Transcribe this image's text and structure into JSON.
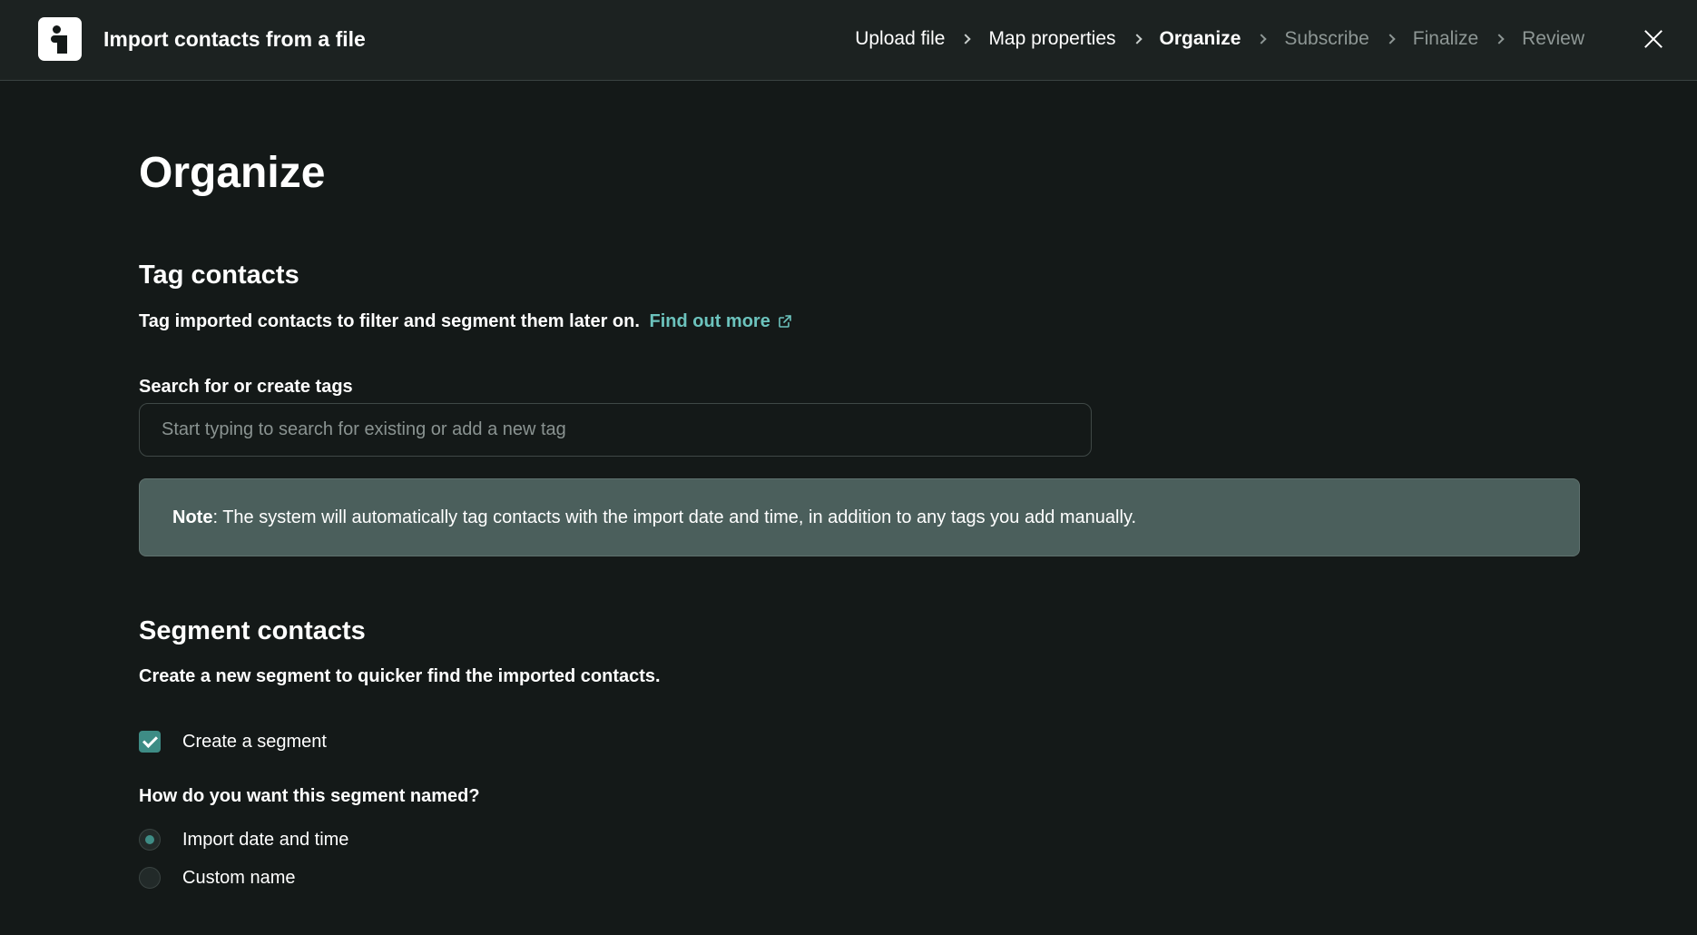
{
  "header": {
    "app_title": "Import contacts from a file",
    "steps": [
      {
        "label": "Upload file",
        "state": "done"
      },
      {
        "label": "Map properties",
        "state": "done"
      },
      {
        "label": "Organize",
        "state": "current"
      },
      {
        "label": "Subscribe",
        "state": "future"
      },
      {
        "label": "Finalize",
        "state": "future"
      },
      {
        "label": "Review",
        "state": "future"
      }
    ],
    "close_icon": "close-icon"
  },
  "main": {
    "page_title": "Organize",
    "tag_section": {
      "title": "Tag contacts",
      "description": "Tag imported contacts to filter and segment them later on.",
      "link_text": "Find out more",
      "link_icon": "external-link-icon",
      "search_label": "Search for or create tags",
      "search_value": "",
      "search_placeholder": "Start typing to search for existing or add a new tag",
      "note_label": "Note",
      "note_text": ": The system will automatically tag contacts with the import date and time, in addition to any tags you add manually."
    },
    "segment_section": {
      "title": "Segment contacts",
      "description": "Create a new segment to quicker find the imported contacts.",
      "create_segment_label": "Create a segment",
      "create_segment_checked": true,
      "naming_question": "How do you want this segment named?",
      "naming_options": [
        {
          "label": "Import date and time",
          "selected": true
        },
        {
          "label": "Custom name",
          "selected": false
        }
      ]
    }
  },
  "colors": {
    "background": "#141918",
    "header_background": "#1c2221",
    "accent": "#3e8c85",
    "link": "#6cc3bd",
    "note_background": "#4b5f5c",
    "muted_text": "#8e9795"
  }
}
